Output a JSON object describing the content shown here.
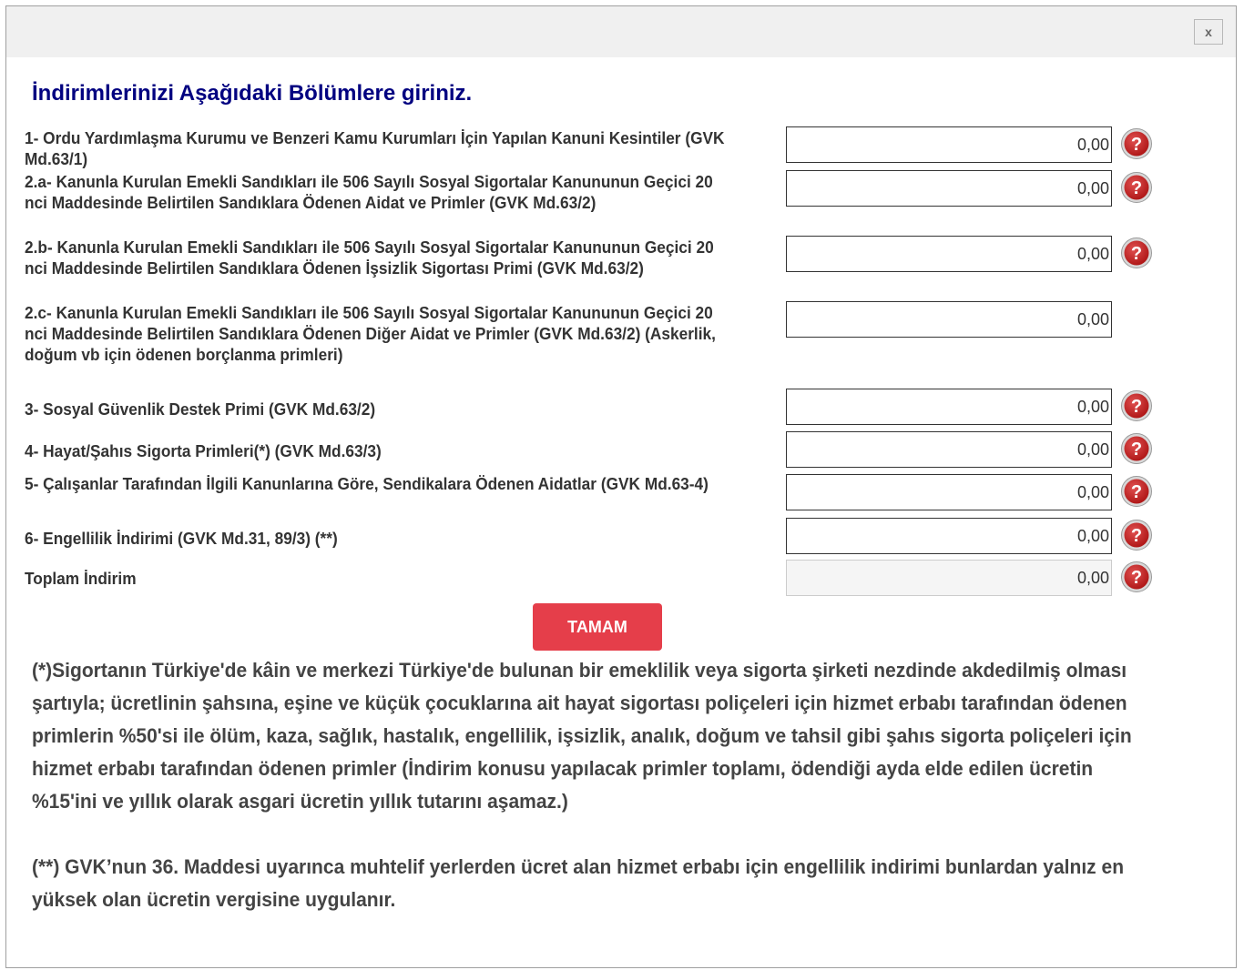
{
  "dialog": {
    "close_label": "x",
    "title": "İndirimlerinizi Aşağıdaki Bölümlere giriniz."
  },
  "rows": [
    {
      "label": "1- Ordu Yardımlaşma Kurumu ve Benzeri Kamu Kurumları İçin Yapılan Kanuni Kesintiler (GVK Md.63/1)",
      "value": "0,00",
      "help": true
    },
    {
      "label": "2.a- Kanunla Kurulan Emekli Sandıkları ile 506 Sayılı Sosyal Sigortalar Kanununun Geçici 20 nci Maddesinde Belirtilen Sandıklara Ödenen Aidat ve Primler (GVK Md.63/2)",
      "value": "0,00",
      "help": true
    },
    {
      "label": "2.b- Kanunla Kurulan Emekli Sandıkları ile 506 Sayılı Sosyal Sigortalar Kanununun Geçici 20 nci Maddesinde Belirtilen Sandıklara Ödenen İşsizlik Sigortası Primi (GVK Md.63/2)",
      "value": "0,00",
      "help": true
    },
    {
      "label": "2.c- Kanunla Kurulan Emekli Sandıkları ile 506 Sayılı Sosyal Sigortalar Kanununun Geçici 20 nci Maddesinde Belirtilen Sandıklara Ödenen Diğer Aidat ve Primler (GVK Md.63/2) (Askerlik, doğum vb için ödenen borçlanma primleri)",
      "value": "0,00",
      "help": false
    },
    {
      "label": "3- Sosyal Güvenlik Destek Primi (GVK Md.63/2)",
      "value": "0,00",
      "help": true
    },
    {
      "label": "4- Hayat/Şahıs Sigorta Primleri(*) (GVK Md.63/3)",
      "value": "0,00",
      "help": true
    },
    {
      "label": "5- Çalışanlar Tarafından İlgili Kanunlarına Göre, Sendikalara Ödenen Aidatlar (GVK Md.63-4)",
      "value": "0,00",
      "help": true
    },
    {
      "label": "6- Engellilik İndirimi (GVK Md.31, 89/3) (**)",
      "value": "0,00",
      "help": true
    }
  ],
  "total": {
    "label": "Toplam İndirim",
    "value": "0,00"
  },
  "ok_label": "TAMAM",
  "notes": {
    "note1": "(*)Sigortanın Türkiye'de kâin ve merkezi Türkiye'de bulunan bir emeklilik veya sigorta şirketi nezdinde akdedilmiş olması şartıyla; ücretlinin şahsına, eşine ve küçük çocuklarına ait hayat sigortası poliçeleri için hizmet erbabı tarafından ödenen primlerin %50'si ile ölüm, kaza, sağlık, hastalık, engellilik, işsizlik, analık, doğum ve tahsil gibi şahıs sigorta poliçeleri için hizmet erbabı tarafından ödenen primler (İndirim konusu yapılacak primler toplamı, ödendiği ayda elde edilen ücretin %15'ini ve yıllık olarak asgari ücretin yıllık tutarını aşamaz.)",
    "note2": "(**) GVK’nun 36. Maddesi uyarınca muhtelif yerlerden ücret alan hizmet erbabı için engellilik indirimi bunlardan yalnız en yüksek olan ücretin vergisine uygulanır."
  },
  "colors": {
    "title": "#000080",
    "button": "#e53e4a",
    "help_icon": "#b01818"
  },
  "icons": {
    "help": "question-mark-icon",
    "close": "close-icon"
  }
}
